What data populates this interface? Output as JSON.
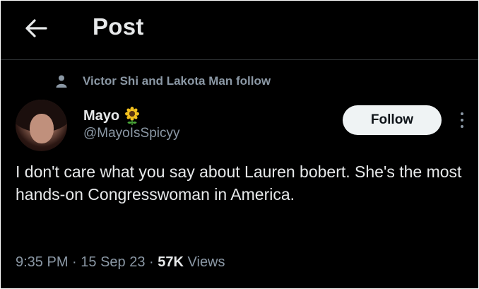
{
  "header": {
    "back_icon": "arrow-left-icon",
    "title": "Post"
  },
  "social_context": {
    "icon": "person-icon",
    "text": "Victor Shi and Lakota Man follow"
  },
  "author": {
    "display_name": "Mayo",
    "name_emoji": "sunflower-icon",
    "handle": "@MayoIsSpicyy",
    "avatar": "avatar"
  },
  "follow_button": {
    "label": "Follow"
  },
  "more_icon": "more-vertical-icon",
  "post": {
    "text": "I don't care what you say about Lauren bobert. She's the most hands-on Congresswoman in America."
  },
  "meta": {
    "time": "9:35 PM",
    "separator": " · ",
    "date": "15 Sep 23",
    "views_count": "57K",
    "views_label": "Views"
  },
  "colors": {
    "background": "#000000",
    "text_primary": "#e7e9ea",
    "text_secondary": "#8b98a5",
    "follow_bg": "#eff3f4",
    "divider": "#2f3336"
  }
}
